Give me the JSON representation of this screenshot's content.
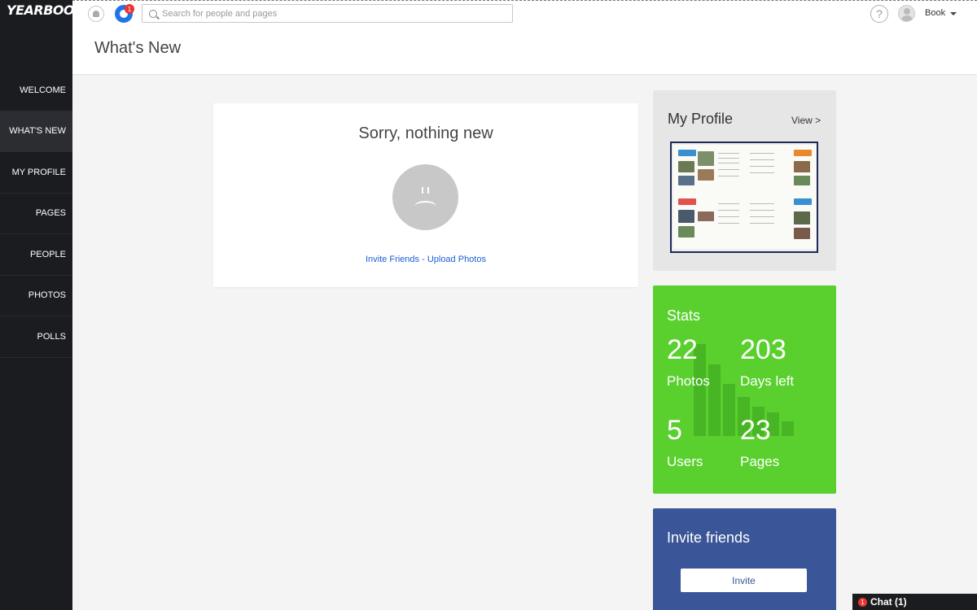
{
  "app": {
    "logo": "YEARBOOK"
  },
  "sidebar": {
    "items": [
      {
        "label": "WELCOME"
      },
      {
        "label": "WHAT'S NEW"
      },
      {
        "label": "MY PROFILE"
      },
      {
        "label": "PAGES"
      },
      {
        "label": "PEOPLE"
      },
      {
        "label": "PHOTOS"
      },
      {
        "label": "POLLS"
      }
    ],
    "active": "WHAT'S NEW"
  },
  "topbar": {
    "notification_count": "1",
    "search_placeholder": "Search for people and pages",
    "search_value": "",
    "help_glyph": "?",
    "user_name": "Book"
  },
  "header": {
    "title": "What's New"
  },
  "feed": {
    "empty_title": "Sorry, nothing new",
    "invite_link": "Invite Friends",
    "separator": " - ",
    "upload_link": "Upload Photos"
  },
  "profile": {
    "title": "My Profile",
    "view_link": "View >"
  },
  "stats": {
    "title": "Stats",
    "items": [
      {
        "value": "22",
        "label": "Photos"
      },
      {
        "value": "203",
        "label": "Days left"
      },
      {
        "value": "5",
        "label": "Users"
      },
      {
        "value": "23",
        "label": "Pages"
      }
    ],
    "bg_color": "#5ad02e"
  },
  "invite": {
    "title": "Invite friends",
    "button_label": "Invite",
    "bg_color": "#3b5599"
  },
  "chat": {
    "badge": "1",
    "label": "Chat (1)"
  },
  "icons": [
    "bell-icon",
    "notification-icon",
    "search-icon",
    "help-icon",
    "avatar",
    "caret-down-icon",
    "sad-face-icon"
  ]
}
